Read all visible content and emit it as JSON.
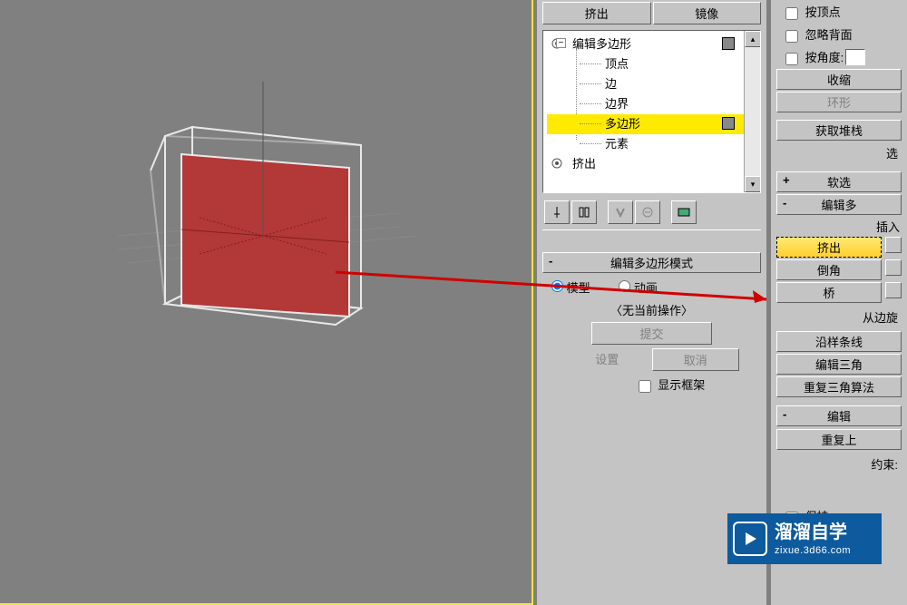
{
  "top_buttons": {
    "extrude": "挤出",
    "mirror": "镜像"
  },
  "tree": {
    "root": "编辑多边形",
    "items": [
      "顶点",
      "边",
      "边界",
      "多边形",
      "元素"
    ],
    "selected_index": 3,
    "extrude_node": "挤出"
  },
  "rollup": {
    "edit_poly_mode": "编辑多边形模式",
    "model": "模型",
    "animation": "动画",
    "no_current": "〈无当前操作〉",
    "commit": "提交",
    "settings": "设置",
    "cancel": "取消",
    "show_cage": "显示框架"
  },
  "right_panel": {
    "by_vertex": "按顶点",
    "ignore_back": "忽略背面",
    "by_angle": "按角度:",
    "shrink": "收缩",
    "ring": "环形",
    "get_stack": "获取堆栈",
    "soft_sel_header": "软选",
    "edit_poly_header": "编辑多",
    "insert": "插入",
    "extrude": "挤出",
    "bevel": "倒角",
    "bridge": "桥",
    "from_edge": "从边旋",
    "along_spline": "沿样条线",
    "edit_tri": "编辑三角",
    "retri": "重复三角算法",
    "edit_header": "编辑",
    "repeat_last": "重复上",
    "constraint": "约束:",
    "preserve": "保持"
  },
  "watermark": {
    "main": "溜溜自学",
    "sub": "zixue.3d66.com"
  }
}
